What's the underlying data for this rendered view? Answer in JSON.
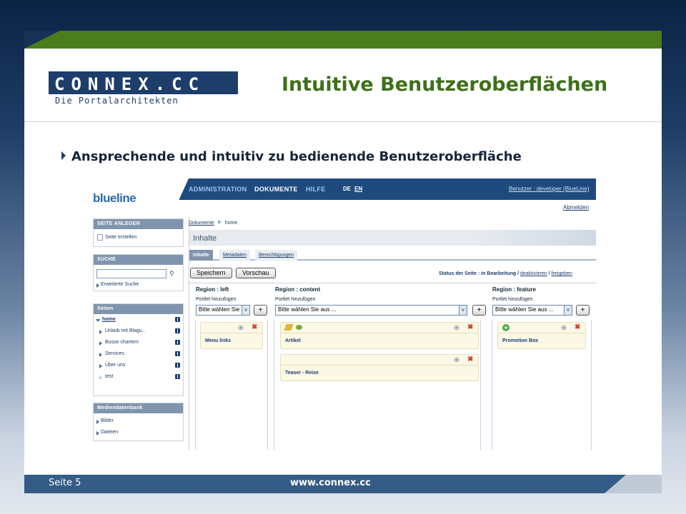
{
  "slide": {
    "title": "Intuitive Benutzeroberflächen",
    "bullet": "Ansprechende und intuitiv zu bedienende Benutzeroberfläche",
    "footer_page": "Seite 5",
    "footer_url": "www.connex.cc"
  },
  "logo": {
    "text": "CONNEX.CC",
    "tagline": "Die Portalarchitekten"
  },
  "app": {
    "logo": "blueline",
    "nav": [
      "ADMINISTRATION",
      "DOKUMENTE",
      "HILFE"
    ],
    "nav_active": "DOKUMENTE",
    "lang": [
      "DE",
      "EN"
    ],
    "user": "Benutzer : developer (BlueLine)",
    "logout": "Abmelden",
    "sidebar": {
      "seite_anlegen": {
        "header": "SEITE ANLEGEN",
        "item": "Seite erstellen"
      },
      "suche": {
        "header": "SUCHE",
        "item": "Erweiterte Suche"
      },
      "seiten": {
        "header": "Seiten",
        "root": "home",
        "items": [
          "Urlaub mit Blagu..",
          "Busse chartern",
          "Services",
          "Über uns",
          "test"
        ]
      },
      "medien": {
        "header": "Mediendatenbank",
        "items": [
          "Bilder",
          "Dateien"
        ]
      }
    },
    "breadcrumb": {
      "root": "Dokumente",
      "current": "home"
    },
    "page_title": "Inhalte",
    "tabs": [
      "Inhalte",
      "Metadaten",
      "Berechtigungen"
    ],
    "buttons": {
      "save": "Speichern",
      "preview": "Vorschau"
    },
    "status": {
      "label": "Status der Seite : in Bearbeitung /",
      "deactivate": "deaktivieren",
      "sep": "/",
      "publish": "freigeben"
    },
    "regions": [
      {
        "title": "Region : left",
        "sub": "Portlet hinzufügen",
        "select": "Bitte wählen Sie aus ...",
        "portlets": [
          "Menu links"
        ]
      },
      {
        "title": "Region : content",
        "sub": "Portlet hinzufügen",
        "select": "Bitte wählen Sie aus ...",
        "portlets": [
          "Artikel",
          "Teaser - Reise"
        ]
      },
      {
        "title": "Region : feature",
        "sub": "Portlet hinzufügen",
        "select": "Bitte wählen Sie aus ...",
        "portlets": [
          "Promotion Box"
        ]
      }
    ],
    "add_label": "+"
  }
}
